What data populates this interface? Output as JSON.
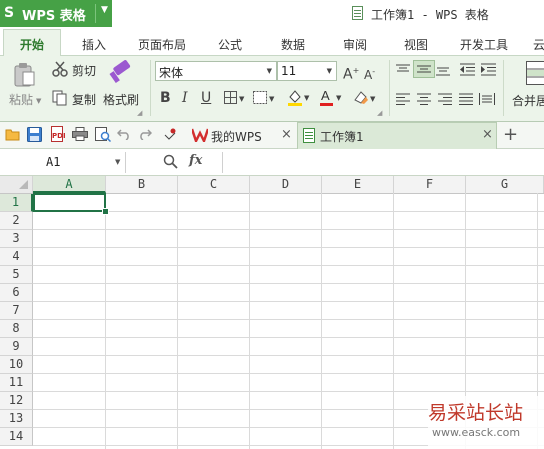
{
  "app": {
    "name": "WPS 表格",
    "logo_letter": "S",
    "document_title": "工作簿1 - WPS 表格",
    "brand_color": "#46a146"
  },
  "tabs": [
    {
      "label": "开始",
      "active": true
    },
    {
      "label": "插入"
    },
    {
      "label": "页面布局"
    },
    {
      "label": "公式"
    },
    {
      "label": "数据"
    },
    {
      "label": "审阅"
    },
    {
      "label": "视图"
    },
    {
      "label": "开发工具"
    },
    {
      "label": "云"
    }
  ],
  "ribbon": {
    "paste_label": "粘贴",
    "cut_label": "剪切",
    "copy_label": "复制",
    "format_painter_label": "格式刷",
    "font_name": "宋体",
    "font_size": "11",
    "bold": "B",
    "italic": "I",
    "underline": "U",
    "merge_label": "合并居"
  },
  "doc_tabs": [
    {
      "label": "我的WPS",
      "close": "×"
    },
    {
      "label": "工作簿1",
      "close": "×",
      "active": true
    }
  ],
  "new_tab": "+",
  "formula_bar": {
    "name_box": "A1",
    "fx_label": "fx",
    "formula": ""
  },
  "sheet": {
    "columns": [
      "A",
      "B",
      "C",
      "D",
      "E",
      "F",
      "G"
    ],
    "rows": [
      "1",
      "2",
      "3",
      "4",
      "5",
      "6",
      "7",
      "8",
      "9",
      "10",
      "11",
      "12",
      "13",
      "14"
    ],
    "active_cell": "A1",
    "selection_color": "#217346"
  },
  "watermark": {
    "title": "易采站长站",
    "url": "www.easck.com"
  }
}
